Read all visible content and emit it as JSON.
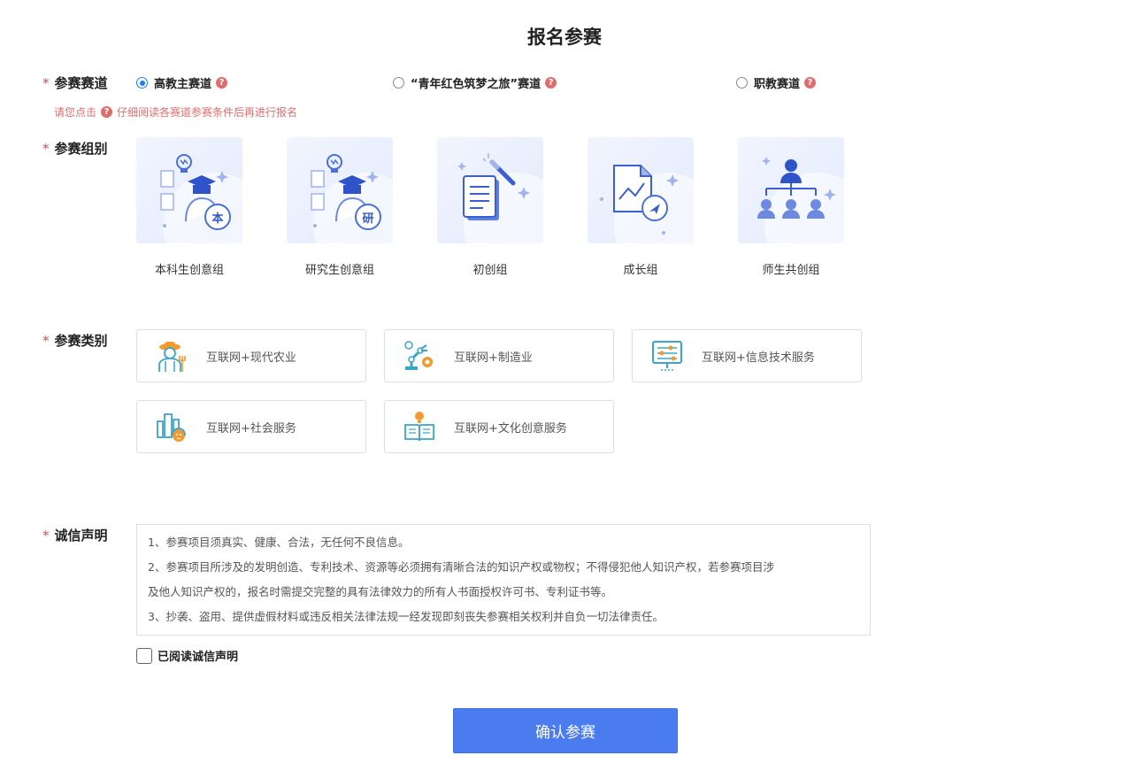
{
  "title": "报名参赛",
  "track": {
    "label": "参赛赛道",
    "options": [
      {
        "label": "高教主赛道",
        "checked": true
      },
      {
        "label": "“青年红色筑梦之旅”赛道",
        "checked": false
      },
      {
        "label": "职教赛道",
        "checked": false
      }
    ],
    "hint_before": "请您点击",
    "hint_after": "仔细阅读各赛道参赛条件后再进行报名"
  },
  "group": {
    "label": "参赛组别",
    "items": [
      {
        "label": "本科生创意组",
        "badge": "本"
      },
      {
        "label": "研究生创意组",
        "badge": "研"
      },
      {
        "label": "初创组"
      },
      {
        "label": "成长组"
      },
      {
        "label": "师生共创组"
      }
    ]
  },
  "category": {
    "label": "参赛类别",
    "items": [
      {
        "label": "互联网+现代农业"
      },
      {
        "label": "互联网+制造业"
      },
      {
        "label": "互联网+信息技术服务"
      },
      {
        "label": "互联网+社会服务"
      },
      {
        "label": "互联网+文化创意服务"
      }
    ]
  },
  "statement": {
    "label": "诚信声明",
    "lines": [
      "1、参赛项目须真实、健康、合法，无任何不良信息。",
      "2、参赛项目所涉及的发明创造、专利技术、资源等必须拥有清晰合法的知识产权或物权；不得侵犯他人知识产权，若参赛项目涉",
      "及他人知识产权的，报名时需提交完整的具有法律效力的所有人书面授权许可书、专利证书等。",
      "3、抄袭、盗用、提供虚假材料或违反相关法律法规一经发现即刻丧失参赛相关权利并自负一切法律责任。"
    ],
    "agree_label": "已阅读诚信声明"
  },
  "help_glyph": "?",
  "required_mark": "*",
  "submit_label": "确认参赛",
  "colors": {
    "primary": "#4a7cf0",
    "required": "#e0474c",
    "hint": "#e06d6d",
    "radio_checked": "#1a7ff0"
  }
}
